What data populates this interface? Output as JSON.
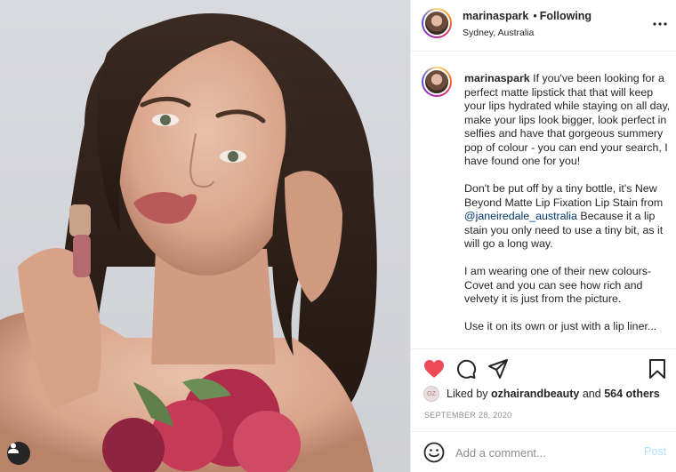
{
  "post": {
    "username": "marinaspark",
    "follow_dot": "•",
    "follow_status": "Following",
    "location": "Sydney, Australia"
  },
  "caption": {
    "username": "marinaspark",
    "paragraph1": "If you've been looking for a perfect matte lipstick that that will keep your lips hydrated while staying on all day, make your lips look bigger, look perfect in selfies and have that gorgeous summery pop of colour - you can end your search, I have found one for you!",
    "paragraph2_pre": "Don't be put off by a tiny bottle, it's New Beyond Matte Lip Fixation Lip Stain from ",
    "paragraph2_mention": "@janeiredale_australia",
    "paragraph2_post": " Because it a lip stain you only need to use a tiny bit, as it will go a long way.",
    "paragraph3": "I am wearing one of their new colours- Covet and you can see how rich and velvety it is just from the picture.",
    "paragraph4_partial": "Use it on its own or just with a lip liner..."
  },
  "likes": {
    "prefix": "Liked by",
    "liker": "ozhairandbeauty",
    "conjunction": "and",
    "others": "564 others",
    "mini_avatar_text": "OZ"
  },
  "date": "SEPTEMBER 28, 2020",
  "comment_box": {
    "placeholder": "Add a comment...",
    "post_label": "Post"
  },
  "icons": {
    "like": "heart-icon",
    "comment": "comment-icon",
    "share": "paper-plane-icon",
    "save": "bookmark-icon",
    "more": "more-horizontal-icon",
    "emoji": "emoji-icon",
    "tagged_user": "user-icon"
  },
  "colors": {
    "liked_heart": "#ed4956",
    "link": "#00376b",
    "post_disabled": "#b2dffc",
    "muted": "#8e8e8e"
  }
}
